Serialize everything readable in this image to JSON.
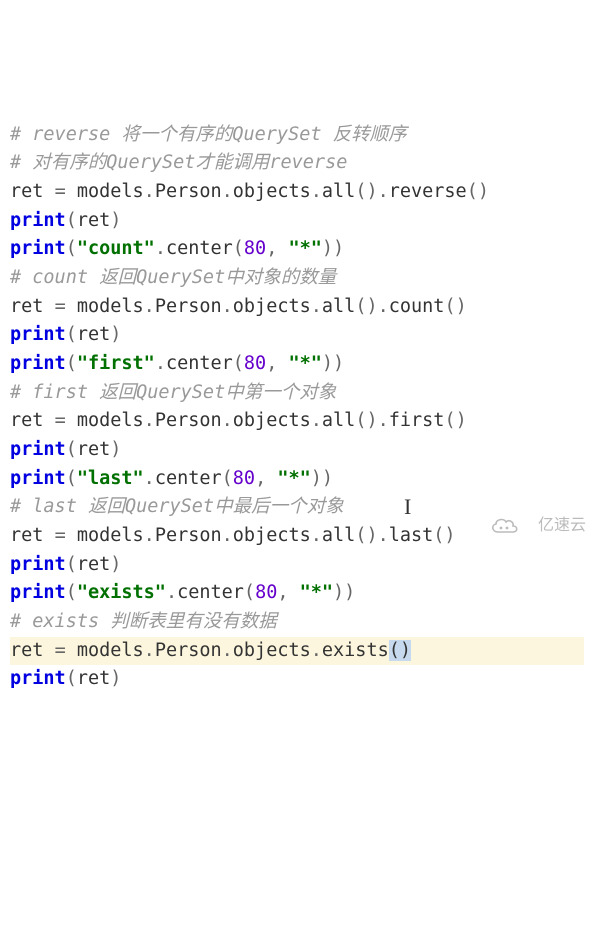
{
  "watermark": "亿速云",
  "lines": [
    {
      "type": "comment",
      "text": "# reverse 将一个有序的QuerySet 反转顺序"
    },
    {
      "type": "comment",
      "text": "# 对有序的QuerySet才能调用reverse"
    },
    {
      "type": "code",
      "tokens": [
        {
          "c": "plain",
          "t": "ret "
        },
        {
          "c": "op",
          "t": "="
        },
        {
          "c": "plain",
          "t": " models"
        },
        {
          "c": "op",
          "t": "."
        },
        {
          "c": "plain",
          "t": "Person"
        },
        {
          "c": "op",
          "t": "."
        },
        {
          "c": "plain",
          "t": "objects"
        },
        {
          "c": "op",
          "t": "."
        },
        {
          "c": "plain",
          "t": "all"
        },
        {
          "c": "op",
          "t": "()."
        },
        {
          "c": "plain",
          "t": "reverse"
        },
        {
          "c": "op",
          "t": "()"
        }
      ]
    },
    {
      "type": "code",
      "tokens": [
        {
          "c": "keyword",
          "t": "print"
        },
        {
          "c": "op",
          "t": "("
        },
        {
          "c": "plain",
          "t": "ret"
        },
        {
          "c": "op",
          "t": ")"
        }
      ]
    },
    {
      "type": "code",
      "tokens": [
        {
          "c": "keyword",
          "t": "print"
        },
        {
          "c": "op",
          "t": "("
        },
        {
          "c": "string",
          "t": "\"count\""
        },
        {
          "c": "op",
          "t": "."
        },
        {
          "c": "plain",
          "t": "center"
        },
        {
          "c": "op",
          "t": "("
        },
        {
          "c": "number",
          "t": "80"
        },
        {
          "c": "op",
          "t": ", "
        },
        {
          "c": "string",
          "t": "\"*\""
        },
        {
          "c": "op",
          "t": "))"
        }
      ]
    },
    {
      "type": "comment",
      "text": "# count 返回QuerySet中对象的数量"
    },
    {
      "type": "code",
      "tokens": [
        {
          "c": "plain",
          "t": "ret "
        },
        {
          "c": "op",
          "t": "="
        },
        {
          "c": "plain",
          "t": " models"
        },
        {
          "c": "op",
          "t": "."
        },
        {
          "c": "plain",
          "t": "Person"
        },
        {
          "c": "op",
          "t": "."
        },
        {
          "c": "plain",
          "t": "objects"
        },
        {
          "c": "op",
          "t": "."
        },
        {
          "c": "plain",
          "t": "all"
        },
        {
          "c": "op",
          "t": "()."
        },
        {
          "c": "plain",
          "t": "count"
        },
        {
          "c": "op",
          "t": "()"
        }
      ]
    },
    {
      "type": "code",
      "tokens": [
        {
          "c": "keyword",
          "t": "print"
        },
        {
          "c": "op",
          "t": "("
        },
        {
          "c": "plain",
          "t": "ret"
        },
        {
          "c": "op",
          "t": ")"
        }
      ]
    },
    {
      "type": "code",
      "tokens": [
        {
          "c": "keyword",
          "t": "print"
        },
        {
          "c": "op",
          "t": "("
        },
        {
          "c": "string",
          "t": "\"first\""
        },
        {
          "c": "op",
          "t": "."
        },
        {
          "c": "plain",
          "t": "center"
        },
        {
          "c": "op",
          "t": "("
        },
        {
          "c": "number",
          "t": "80"
        },
        {
          "c": "op",
          "t": ", "
        },
        {
          "c": "string",
          "t": "\"*\""
        },
        {
          "c": "op",
          "t": "))"
        }
      ]
    },
    {
      "type": "comment",
      "text": "# first 返回QuerySet中第一个对象"
    },
    {
      "type": "code",
      "tokens": [
        {
          "c": "plain",
          "t": "ret "
        },
        {
          "c": "op",
          "t": "="
        },
        {
          "c": "plain",
          "t": " models"
        },
        {
          "c": "op",
          "t": "."
        },
        {
          "c": "plain",
          "t": "Person"
        },
        {
          "c": "op",
          "t": "."
        },
        {
          "c": "plain",
          "t": "objects"
        },
        {
          "c": "op",
          "t": "."
        },
        {
          "c": "plain",
          "t": "all"
        },
        {
          "c": "op",
          "t": "()."
        },
        {
          "c": "plain",
          "t": "first"
        },
        {
          "c": "op",
          "t": "()"
        }
      ]
    },
    {
      "type": "code",
      "tokens": [
        {
          "c": "keyword",
          "t": "print"
        },
        {
          "c": "op",
          "t": "("
        },
        {
          "c": "plain",
          "t": "ret"
        },
        {
          "c": "op",
          "t": ")"
        }
      ]
    },
    {
      "type": "code",
      "tokens": [
        {
          "c": "keyword",
          "t": "print"
        },
        {
          "c": "op",
          "t": "("
        },
        {
          "c": "string",
          "t": "\"last\""
        },
        {
          "c": "op",
          "t": "."
        },
        {
          "c": "plain",
          "t": "center"
        },
        {
          "c": "op",
          "t": "("
        },
        {
          "c": "number",
          "t": "80"
        },
        {
          "c": "op",
          "t": ", "
        },
        {
          "c": "string",
          "t": "\"*\""
        },
        {
          "c": "op",
          "t": "))"
        }
      ]
    },
    {
      "type": "comment",
      "text": "# last 返回QuerySet中最后一个对象"
    },
    {
      "type": "code",
      "tokens": [
        {
          "c": "plain",
          "t": "ret "
        },
        {
          "c": "op",
          "t": "="
        },
        {
          "c": "plain",
          "t": " models"
        },
        {
          "c": "op",
          "t": "."
        },
        {
          "c": "plain",
          "t": "Person"
        },
        {
          "c": "op",
          "t": "."
        },
        {
          "c": "plain",
          "t": "objects"
        },
        {
          "c": "op",
          "t": "."
        },
        {
          "c": "plain",
          "t": "all"
        },
        {
          "c": "op",
          "t": "()."
        },
        {
          "c": "plain",
          "t": "last"
        },
        {
          "c": "op",
          "t": "()"
        }
      ]
    },
    {
      "type": "code",
      "tokens": [
        {
          "c": "keyword",
          "t": "print"
        },
        {
          "c": "op",
          "t": "("
        },
        {
          "c": "plain",
          "t": "ret"
        },
        {
          "c": "op",
          "t": ")"
        }
      ]
    },
    {
      "type": "code",
      "tokens": [
        {
          "c": "keyword",
          "t": "print"
        },
        {
          "c": "op",
          "t": "("
        },
        {
          "c": "string",
          "t": "\"exists\""
        },
        {
          "c": "op",
          "t": "."
        },
        {
          "c": "plain",
          "t": "center"
        },
        {
          "c": "op",
          "t": "("
        },
        {
          "c": "number",
          "t": "80"
        },
        {
          "c": "op",
          "t": ", "
        },
        {
          "c": "string",
          "t": "\"*\""
        },
        {
          "c": "op",
          "t": "))"
        }
      ]
    },
    {
      "type": "comment",
      "text": "# exists 判断表里有没有数据"
    },
    {
      "type": "code",
      "highlight": true,
      "tokens": [
        {
          "c": "plain",
          "t": "ret "
        },
        {
          "c": "op",
          "t": "="
        },
        {
          "c": "plain",
          "t": " models"
        },
        {
          "c": "op",
          "t": "."
        },
        {
          "c": "plain",
          "t": "Person"
        },
        {
          "c": "op",
          "t": "."
        },
        {
          "c": "plain",
          "t": "objects"
        },
        {
          "c": "op",
          "t": "."
        },
        {
          "c": "plain",
          "t": "exists"
        },
        {
          "c": "sel",
          "t": "()"
        }
      ]
    },
    {
      "type": "code",
      "tokens": [
        {
          "c": "keyword",
          "t": "print"
        },
        {
          "c": "op",
          "t": "("
        },
        {
          "c": "plain",
          "t": "ret"
        },
        {
          "c": "op",
          "t": ")"
        }
      ]
    }
  ]
}
